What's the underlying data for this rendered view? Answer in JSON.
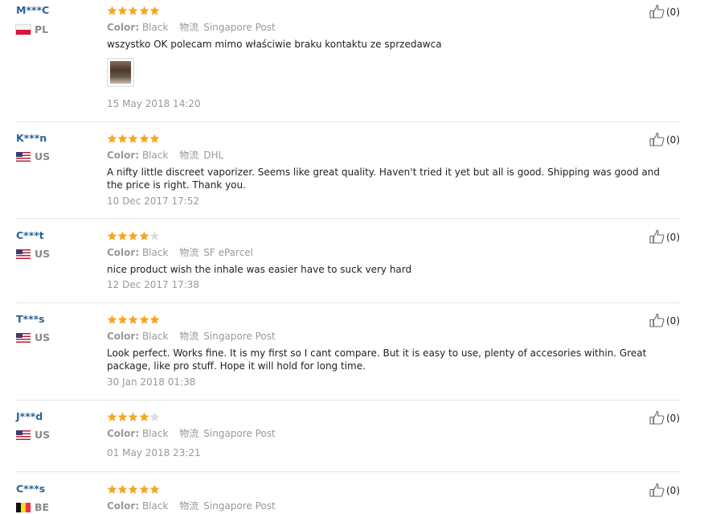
{
  "labels": {
    "color": "Color:",
    "shipping_icon": "物流"
  },
  "reviews": [
    {
      "user": "M***C",
      "country": "PL",
      "flag": "pl",
      "rating": 5,
      "color": "Black",
      "shipping": "Singapore Post",
      "text": "wszystko OK polecam mimo właściwie braku kontaktu ze sprzedawca",
      "has_photo": true,
      "date": "15 May 2018 14:20",
      "helpful": "(0)"
    },
    {
      "user": "K***n",
      "country": "US",
      "flag": "us",
      "rating": 5,
      "color": "Black",
      "shipping": "DHL",
      "text": "A nifty little discreet vaporizer. Seems like great quality. Haven't tried it yet but all is good. Shipping was good and the price is right. Thank you.",
      "date": "10 Dec 2017 17:52",
      "helpful": "(0)"
    },
    {
      "user": "C***t",
      "country": "US",
      "flag": "us",
      "rating": 4,
      "color": "Black",
      "shipping": "SF eParcel",
      "text": "nice product wish the inhale was easier have to suck very hard",
      "date": "12 Dec 2017 17:38",
      "helpful": "(0)"
    },
    {
      "user": "T***s",
      "country": "US",
      "flag": "us",
      "rating": 5,
      "color": "Black",
      "shipping": "Singapore Post",
      "text": "Look perfect. Works fine. It is my first so I cant compare. But it is easy to use, plenty of accesories within. Great package, like pro stuff. Hope it will hold for long time.",
      "date": "30 Jan 2018 01:38",
      "helpful": "(0)"
    },
    {
      "user": "J***d",
      "country": "US",
      "flag": "us",
      "rating": 4,
      "color": "Black",
      "shipping": "Singapore Post",
      "text": "",
      "date": "01 May 2018 23:21",
      "helpful": "(0)"
    },
    {
      "user": "C***s",
      "country": "BE",
      "flag": "be",
      "rating": 5,
      "color": "Black",
      "shipping": "Singapore Post",
      "text": "",
      "date": "",
      "helpful": "(0)"
    }
  ],
  "colors": {
    "star_on": "#f5a623",
    "star_off": "#dcdcdc",
    "user_link": "#2a6496"
  }
}
